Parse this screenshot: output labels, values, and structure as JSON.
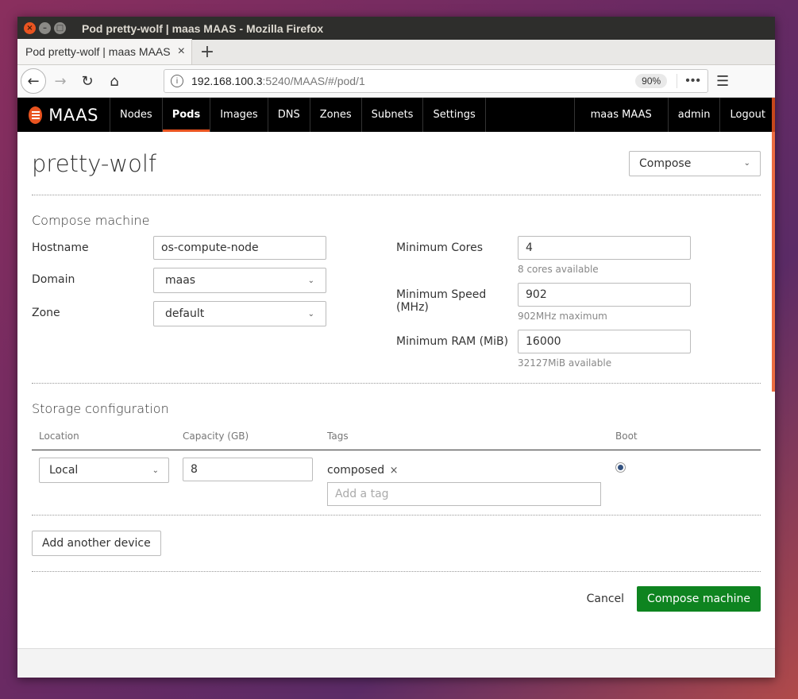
{
  "window": {
    "title": "Pod pretty-wolf | maas MAAS - Mozilla Firefox",
    "close_glyph": "×",
    "min_glyph": "–",
    "max_glyph": "□"
  },
  "browser": {
    "tab_title": "Pod pretty-wolf | maas MAAS",
    "tab_close": "×",
    "new_tab": "+",
    "url_host": "192.168.100.3",
    "url_path": ":5240/MAAS/#/pod/1",
    "zoom": "90%",
    "more": "•••",
    "back_icon": "←",
    "forward_icon": "→",
    "reload_icon": "↻",
    "home_icon": "⌂",
    "menu_icon": "☰",
    "info_icon": "i"
  },
  "nav": {
    "brand": "MAAS",
    "items": [
      {
        "label": "Nodes"
      },
      {
        "label": "Pods"
      },
      {
        "label": "Images"
      },
      {
        "label": "DNS"
      },
      {
        "label": "Zones"
      },
      {
        "label": "Subnets"
      },
      {
        "label": "Settings"
      }
    ],
    "active": "Pods",
    "user_label": "maas MAAS",
    "admin": "admin",
    "logout": "Logout"
  },
  "header": {
    "title": "pretty-wolf",
    "action_select": "Compose",
    "chevron": "⌄"
  },
  "compose": {
    "section_title": "Compose machine",
    "hostname_label": "Hostname",
    "hostname_value": "os-compute-node",
    "domain_label": "Domain",
    "domain_value": "maas",
    "zone_label": "Zone",
    "zone_value": "default",
    "cores_label": "Minimum Cores",
    "cores_value": "4",
    "cores_help": "8 cores available",
    "speed_label": "Minimum Speed (MHz)",
    "speed_value": "902",
    "speed_help": "902MHz maximum",
    "ram_label": "Minimum RAM (MiB)",
    "ram_value": "16000",
    "ram_help": "32127MiB available"
  },
  "storage": {
    "section_title": "Storage configuration",
    "col_location": "Location",
    "col_capacity": "Capacity (GB)",
    "col_tags": "Tags",
    "col_boot": "Boot",
    "row": {
      "location": "Local",
      "capacity": "8",
      "tag": "composed",
      "tag_remove": "×",
      "tag_placeholder": "Add a tag",
      "boot_selected": true
    },
    "add_device": "Add another device"
  },
  "actions": {
    "cancel": "Cancel",
    "submit": "Compose machine"
  },
  "colors": {
    "accent": "#e95420",
    "primary_button": "#0e8420",
    "navbar": "#000000"
  }
}
